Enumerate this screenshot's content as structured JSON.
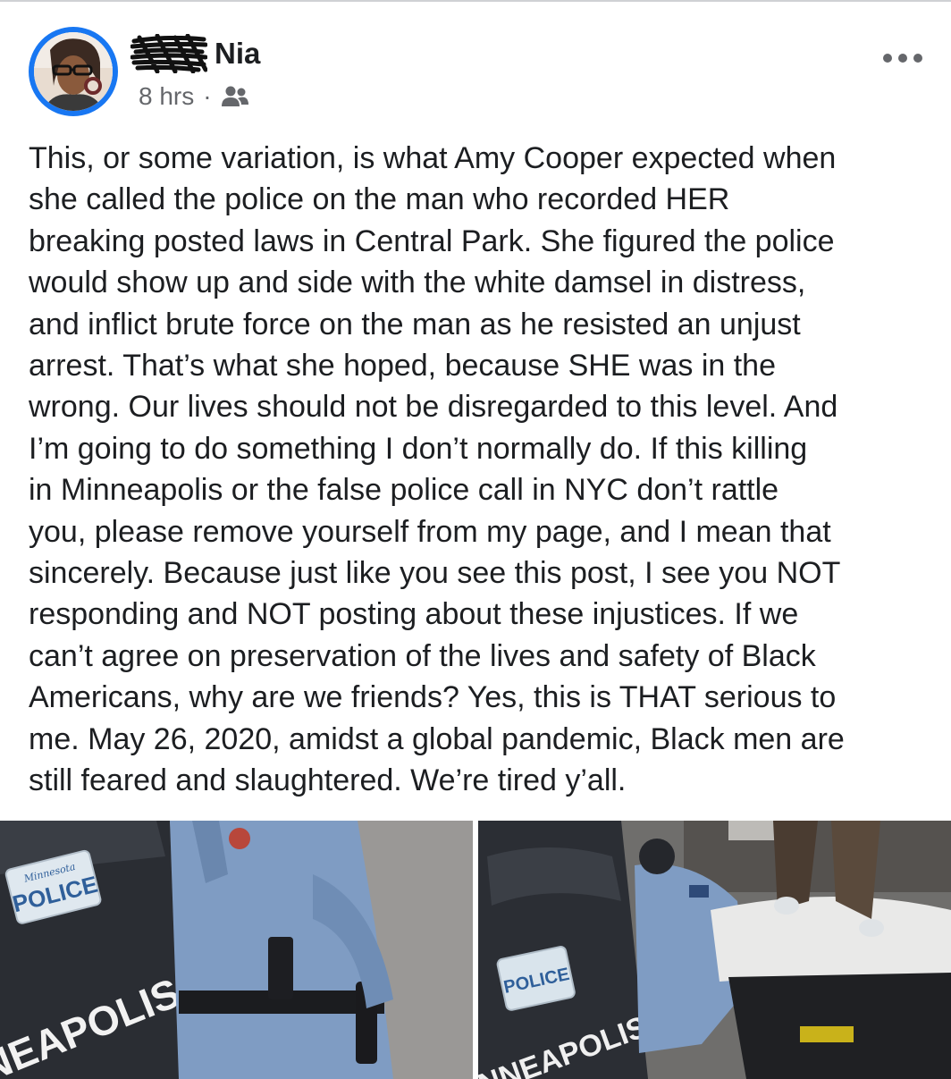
{
  "post": {
    "author_name": "Nia",
    "time": "8 hrs",
    "separator": "·",
    "audience_icon": "friends-icon",
    "more_icon": "more-options-icon",
    "text_lines": [
      "This, or some variation, is what Amy Cooper expected when",
      "she called the police on the man who recorded HER",
      "breaking posted laws in Central Park. She figured the police",
      "would show up and side with the white damsel in distress,",
      "and inflict brute force on the man as he resisted an unjust",
      "arrest. That’s what she hoped, because SHE was in the",
      "wrong. Our lives should not be disregarded to this level. And",
      "I’m going to do something I don’t normally do. If this killing",
      "in Minneapolis or the false police call in NYC don’t rattle",
      "you, please remove yourself from my page, and I mean that",
      "sincerely. Because just like you see this post, I see you NOT",
      "responding and NOT posting about these injustices. If we",
      "can’t agree on preservation of the lives and safety of Black",
      "Americans, why are we friends? Yes, this is THAT serious to",
      "me. May 26, 2020, amidst a global pandemic, Black men are",
      "still feared and slaughtered. We’re tired y’all."
    ]
  },
  "photos": {
    "left": {
      "plate_state": "Minnesota",
      "plate_text": "POLICE",
      "car_text": "NEAPOLIS"
    },
    "right": {
      "plate_text": "POLICE",
      "car_text": "NNEAPOLIS"
    }
  },
  "colors": {
    "accent": "#1877f2",
    "meta_gray": "#65676b",
    "text": "#1c1e21",
    "uniform_blue": "#7f9cc3",
    "vehicle_dark": "#2a2d33"
  }
}
